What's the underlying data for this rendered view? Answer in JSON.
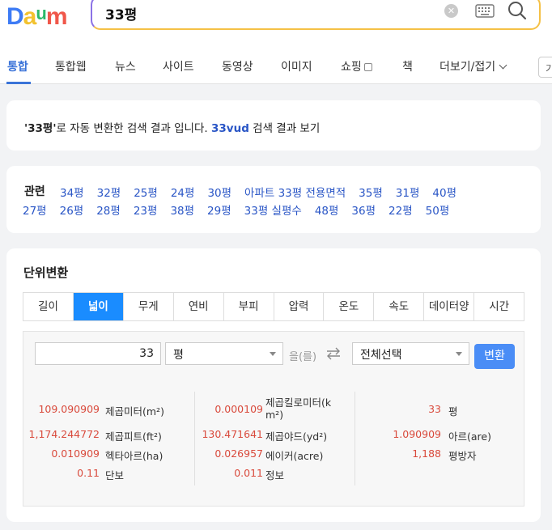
{
  "logo": "Daum",
  "search": {
    "query": "33평"
  },
  "tabs": [
    "통합",
    "통합웹",
    "뉴스",
    "사이트",
    "동영상",
    "이미지",
    "쇼핑",
    "책",
    "더보기/접기"
  ],
  "tab_extra": "기",
  "notice": {
    "quoted": "'33평'",
    "text": "로 자동 변환한 검색 결과 입니다.",
    "alt_query": "33vud",
    "alt_suffix": "검색 결과 보기"
  },
  "related": {
    "title": "관련",
    "row1": [
      "34평",
      "32평",
      "25평",
      "24평",
      "30평",
      "아파트 33평 전용면적",
      "35평",
      "31평",
      "40평"
    ],
    "row2": [
      "27평",
      "26평",
      "28평",
      "23평",
      "38평",
      "29평",
      "33평 실평수",
      "48평",
      "36평",
      "22평",
      "50평"
    ]
  },
  "unit": {
    "title": "단위변환",
    "tabs": [
      "길이",
      "넓이",
      "무게",
      "연비",
      "부피",
      "압력",
      "온도",
      "속도",
      "데이터양",
      "시간"
    ],
    "active_tab": "넓이",
    "amount": "33",
    "from_unit": "평",
    "particle": "을(를)",
    "to_unit": "전체선택",
    "convert_label": "변환",
    "results": [
      {
        "value": "109.090909",
        "unit": "제곱미터(m²)"
      },
      {
        "value": "1,174.244772",
        "unit": "제곱피트(ft²)"
      },
      {
        "value": "0.010909",
        "unit": "헥타아르(ha)"
      },
      {
        "value": "0.11",
        "unit": "단보"
      },
      {
        "value": "0.000109",
        "unit": "제곱킬로미터(km²)"
      },
      {
        "value": "130.471641",
        "unit": "제곱야드(yd²)"
      },
      {
        "value": "0.026957",
        "unit": "에이커(acre)"
      },
      {
        "value": "0.011",
        "unit": "정보"
      },
      {
        "value": "33",
        "unit": "평"
      },
      {
        "value": "1.090909",
        "unit": "아르(are)"
      },
      {
        "value": "1,188",
        "unit": "평방자"
      }
    ]
  },
  "colors": {
    "accent": "#1a8cff",
    "link": "#2a56c6",
    "value": "#d94a3c"
  }
}
